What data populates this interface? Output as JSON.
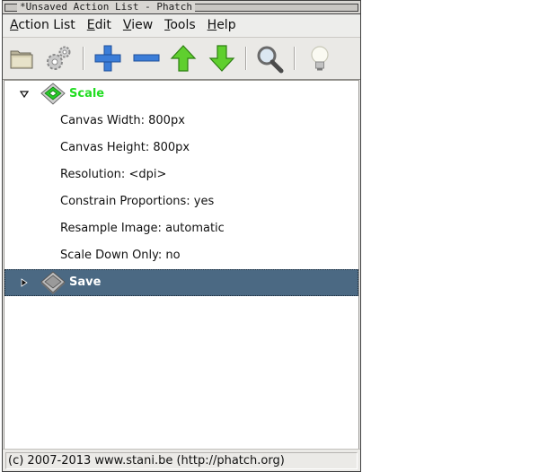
{
  "window": {
    "title": "*Unsaved Action List - Phatch"
  },
  "menubar": {
    "items": [
      {
        "mnemonic": "A",
        "rest": "ction List"
      },
      {
        "mnemonic": "E",
        "rest": "dit"
      },
      {
        "mnemonic": "V",
        "rest": "iew"
      },
      {
        "mnemonic": "T",
        "rest": "ools"
      },
      {
        "mnemonic": "H",
        "rest": "elp"
      }
    ]
  },
  "toolbar": {
    "buttons": [
      {
        "icon": "folder-open-icon"
      },
      {
        "icon": "gears-icon"
      },
      {
        "icon": "plus-icon"
      },
      {
        "icon": "minus-icon"
      },
      {
        "icon": "arrow-up-icon"
      },
      {
        "icon": "arrow-down-icon"
      },
      {
        "icon": "magnifier-icon"
      },
      {
        "icon": "lightbulb-icon"
      }
    ]
  },
  "actions": [
    {
      "label": "Scale",
      "expanded": true,
      "icon_color": "#22cc22",
      "params": [
        "Canvas Width: 800px",
        "Canvas Height: 800px",
        "Resolution: <dpi>",
        "Constrain Proportions: yes",
        "Resample Image: automatic",
        "Scale Down Only: no"
      ]
    },
    {
      "label": "Save",
      "expanded": false,
      "selected": true,
      "icon_color": "#9a9a9a",
      "params": []
    }
  ],
  "statusbar": {
    "text": "(c) 2007-2013 www.stani.be (http://phatch.org)"
  },
  "colors": {
    "selection": "#4b6983",
    "scale_label": "#22dd22"
  }
}
